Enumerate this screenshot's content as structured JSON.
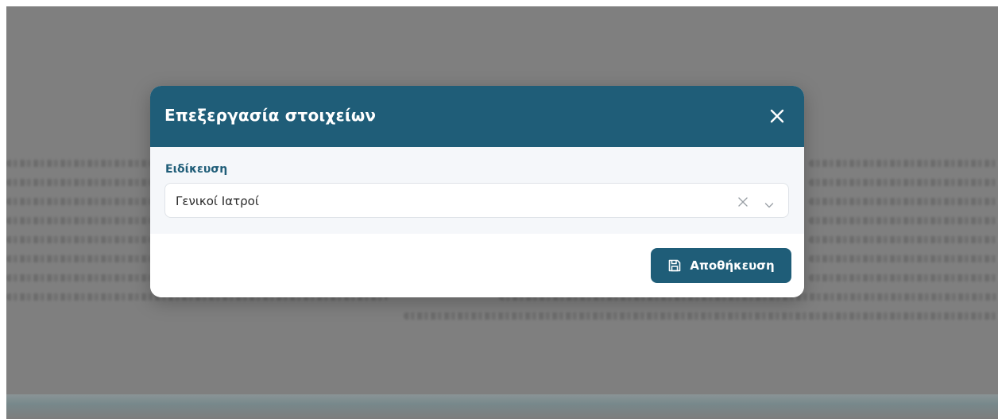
{
  "modal": {
    "title": "Επεξεργασία στοιχείων",
    "close_icon": "close-icon",
    "field": {
      "label": "Ειδίκευση",
      "value": "Γενικοί Ιατροί",
      "clear_icon": "clear-icon",
      "dropdown_icon": "chevron-down-icon"
    },
    "save_button": {
      "label": "Αποθήκευση",
      "icon": "save-icon"
    }
  },
  "colors": {
    "primary": "#1f5d78",
    "backdrop": "#7f7f7f",
    "body_bg": "#f5f7fa"
  }
}
